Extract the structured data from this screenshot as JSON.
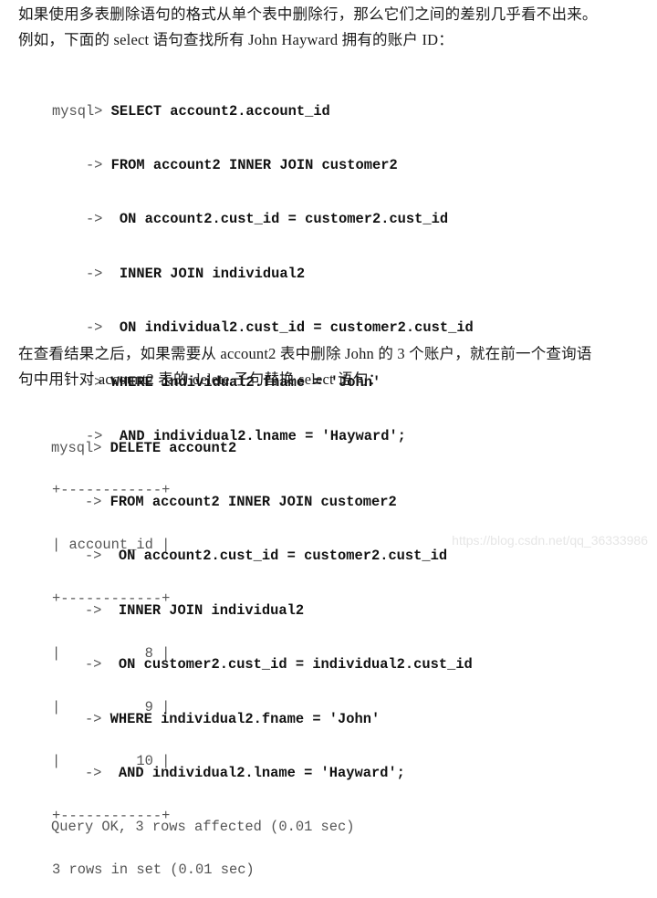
{
  "paragraph1": {
    "line1": "如果使用多表删除语句的格式从单个表中删除行，那么它们之间的差别几乎看不出来。",
    "line2": "例如，下面的 select 语句查找所有 John Hayward 拥有的账户 ID："
  },
  "query1": {
    "lines": [
      {
        "prompt": "mysql> ",
        "sql": "SELECT account2.account_id"
      },
      {
        "prompt": "    -> ",
        "sql": "FROM account2 INNER JOIN customer2"
      },
      {
        "prompt": "    ->  ",
        "sql": "ON account2.cust_id = customer2.cust_id"
      },
      {
        "prompt": "    ->  ",
        "sql": "INNER JOIN individual2"
      },
      {
        "prompt": "    ->  ",
        "sql": "ON individual2.cust_id = customer2.cust_id"
      },
      {
        "prompt": "    -> ",
        "sql": "WHERE individual2.fname = 'John'"
      },
      {
        "prompt": "    ->  ",
        "sql": "AND individual2.lname = 'Hayward';"
      }
    ],
    "result_table": {
      "border": "+------------+",
      "header": "| account_id |",
      "column": "account_id",
      "rows": [
        "|          8 |",
        "|          9 |",
        "|         10 |"
      ],
      "values": [
        8,
        9,
        10
      ]
    },
    "status": "3 rows in set (0.01 sec)"
  },
  "paragraph2": {
    "line1": "在查看结果之后，如果需要从 account2 表中删除 John 的 3 个账户，就在前一个查询语",
    "line2": "句中用针对 account2 表的 delete 子句替换 select 语句："
  },
  "query2": {
    "lines": [
      {
        "prompt": "mysql> ",
        "sql": "DELETE account2"
      },
      {
        "prompt": "    -> ",
        "sql": "FROM account2 INNER JOIN customer2"
      },
      {
        "prompt": "    ->  ",
        "sql": "ON account2.cust_id = customer2.cust_id"
      },
      {
        "prompt": "    ->  ",
        "sql": "INNER JOIN individual2"
      },
      {
        "prompt": "    ->  ",
        "sql": "ON customer2.cust_id = individual2.cust_id"
      },
      {
        "prompt": "    -> ",
        "sql": "WHERE individual2.fname = 'John'"
      },
      {
        "prompt": "    ->  ",
        "sql": "AND individual2.lname = 'Hayward';"
      }
    ],
    "status": "Query OK, 3 rows affected (0.01 sec)"
  },
  "watermark": "https://blog.csdn.net/qq_36333986"
}
